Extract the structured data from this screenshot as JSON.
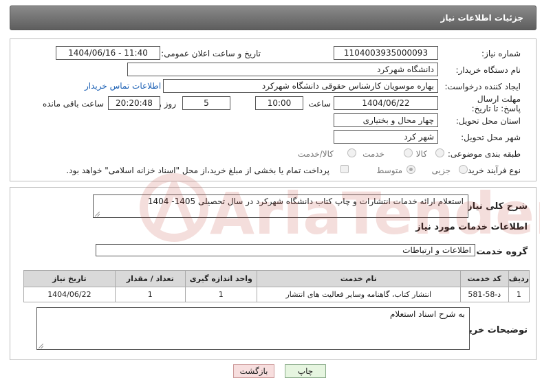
{
  "header": {
    "title": "جزئیات اطلاعات نیاز"
  },
  "form": {
    "need_number_label": "شماره نیاز:",
    "need_number": "1104003935000093",
    "announce_label": "تاریخ و ساعت اعلان عمومی:",
    "announce_value": "1404/06/16 - 11:40",
    "buyer_label": "نام دستگاه خریدار:",
    "buyer": "دانشگاه شهرکرد",
    "creator_label": "ایجاد کننده درخواست:",
    "creator": "بهاره موسویان کارشناس حقوقی دانشگاه شهرکرد",
    "contact_link": "اطلاعات تماس خریدار",
    "deadline_label": "مهلت ارسال پاسخ: تا تاریخ:",
    "deadline_date": "1404/06/22",
    "time_label": "ساعت",
    "deadline_time": "10:00",
    "days_value": "5",
    "days_label": "روز و",
    "remaining_time": "20:20:48",
    "remaining_label": "ساعت باقی مانده",
    "province_label": "استان محل تحویل:",
    "province": "چهار محال و بختیاری",
    "city_label": "شهر محل تحویل:",
    "city": "شهر کرد",
    "category_label": "طبقه بندی موضوعی:",
    "category_options": [
      "کالا",
      "خدمت",
      "کالا/خدمت"
    ],
    "purchase_type_label": "نوع فرآیند خرید :",
    "purchase_options": [
      "جزیی",
      "متوسط"
    ],
    "payment_note": "پرداخت تمام یا بخشی از مبلغ خرید،از محل \"اسناد خزانه اسلامی\" خواهد بود."
  },
  "details": {
    "summary_label": "شرح کلی نیاز:",
    "summary": "استعلام ارائه خدمات انتشارات و چاپ کتاب دانشگاه شهرکرد در سال تحصیلی 1405- 1404",
    "services_heading": "اطلاعات خدمات مورد نیاز",
    "service_group_label": "گروه خدمت:",
    "service_group": "اطلاعات و ارتباطات",
    "table": {
      "headers": [
        "ردیف",
        "کد خدمت",
        "نام خدمت",
        "واحد اندازه گیری",
        "تعداد / مقدار",
        "تاریخ نیاز"
      ],
      "rows": [
        [
          "1",
          "د-58-581",
          "انتشار کتاب، گاهنامه وسایر فعالیت های انتشار",
          "1",
          "1",
          "1404/06/22"
        ]
      ]
    },
    "buyer_notes_label": "توضیحات خریدار:",
    "buyer_notes": "به شرح اسناد استعلام"
  },
  "buttons": {
    "print": "چاپ",
    "back": "بازگشت"
  },
  "watermark": {
    "text": "AriaTender.neT"
  },
  "colors": {
    "header": "#6e6e6e",
    "link": "#1a5fb4",
    "back_btn": "#f7dede",
    "print_btn": "#e6f5e0"
  }
}
